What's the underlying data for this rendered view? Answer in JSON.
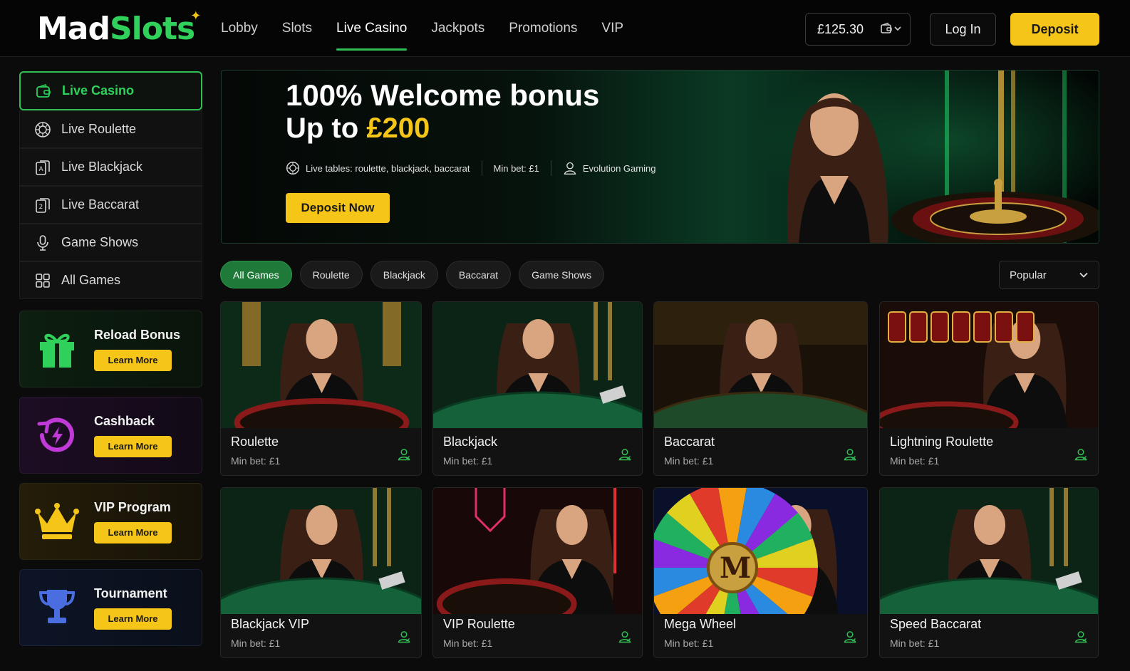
{
  "brand": {
    "name_part1": "Mad",
    "name_part2": "Slots",
    "accent_green": "#2fd15a",
    "accent_yellow": "#f5c518"
  },
  "nav": {
    "items": [
      {
        "label": "Lobby",
        "active": false
      },
      {
        "label": "Slots",
        "active": false
      },
      {
        "label": "Live Casino",
        "active": true
      },
      {
        "label": "Jackpots",
        "active": false
      },
      {
        "label": "Promotions",
        "active": false
      },
      {
        "label": "VIP",
        "active": false
      }
    ]
  },
  "account": {
    "balance": "£125.30",
    "login_label": "Log In",
    "deposit_label": "Deposit",
    "wallet_icon": "wallet-icon"
  },
  "sidebar": {
    "items": [
      {
        "label": "Live Casino",
        "icon": "live-casino-icon",
        "active": true
      },
      {
        "label": "Live Roulette",
        "icon": "roulette-icon"
      },
      {
        "label": "Live Blackjack",
        "icon": "cards-icon"
      },
      {
        "label": "Live Baccarat",
        "icon": "cards-icon"
      },
      {
        "label": "Game Shows",
        "icon": "microphone-icon"
      },
      {
        "label": "All Games",
        "icon": "grid-icon"
      }
    ],
    "promos": [
      {
        "title": "Reload Bonus",
        "button": "Learn More",
        "icon": "gift-icon"
      },
      {
        "title": "Cashback",
        "button": "Learn More",
        "icon": "cashback-icon"
      },
      {
        "title": "VIP Program",
        "button": "Learn More",
        "icon": "crown-icon"
      },
      {
        "title": "Tournament",
        "button": "Learn More",
        "icon": "trophy-icon"
      }
    ]
  },
  "banner": {
    "headline": "100% Welcome bonus",
    "subline_prefix": "Up to ",
    "subline_amount": "£200",
    "meta": [
      {
        "text": "Live tables: roulette, blackjack, baccarat",
        "icon": "roulette-icon"
      },
      {
        "text": "Min bet: £1"
      },
      {
        "text": "Evolution Gaming",
        "icon": "user-icon"
      }
    ],
    "cta": "Deposit Now"
  },
  "filters": {
    "chips": [
      {
        "label": "All Games",
        "active": true
      },
      {
        "label": "Roulette"
      },
      {
        "label": "Blackjack"
      },
      {
        "label": "Baccarat"
      },
      {
        "label": "Game Shows"
      }
    ],
    "sort": "Popular"
  },
  "games": [
    {
      "name": "Roulette",
      "min_bet": "Min bet:  £1",
      "theme": "roulette"
    },
    {
      "name": "Blackjack",
      "min_bet": "Min bet:  £1",
      "theme": "blackjack"
    },
    {
      "name": "Baccarat",
      "min_bet": "Min bet:  £1",
      "theme": "baccarat"
    },
    {
      "name": "Lightning Roulette",
      "min_bet": "Min bet:  £1",
      "theme": "lightning"
    },
    {
      "name": "Blackjack VIP",
      "min_bet": "Min bet:  £1",
      "theme": "blackjack"
    },
    {
      "name": "VIP Roulette",
      "min_bet": "Min bet:  £1",
      "theme": "vip-roulette"
    },
    {
      "name": "Mega Wheel",
      "min_bet": "Min bet:  £1",
      "theme": "wheel"
    },
    {
      "name": "Speed Baccarat",
      "min_bet": "Min bet:  £1",
      "theme": "blackjack"
    }
  ]
}
